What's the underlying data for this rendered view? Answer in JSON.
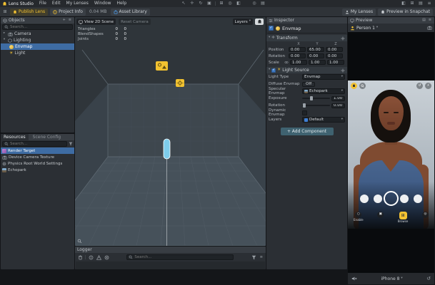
{
  "menubar": {
    "app_title": "Lens Studio",
    "items": [
      "File",
      "Edit",
      "My Lenses",
      "Window",
      "Help"
    ]
  },
  "toolbar": {
    "publish_label": "Publish Lens",
    "project_info_label": "Project Info",
    "project_size": "0.04 MB",
    "asset_library_label": "Asset Library",
    "my_lenses_label": "My Lenses",
    "preview_snapchat_label": "Preview in Snapchat"
  },
  "objects_panel": {
    "title": "Objects",
    "search_placeholder": "Search...",
    "items": [
      {
        "label": "Camera",
        "depth": 0,
        "selected": false
      },
      {
        "label": "Lighting",
        "depth": 0,
        "selected": false
      },
      {
        "label": "Envmap",
        "depth": 1,
        "selected": true
      },
      {
        "label": "Light",
        "depth": 1,
        "selected": false
      }
    ]
  },
  "resources_panel": {
    "tabs": [
      {
        "label": "Resources",
        "active": true
      },
      {
        "label": "Scene Config",
        "active": false
      }
    ],
    "search_placeholder": "Search...",
    "items": [
      {
        "label": "Render Target",
        "selected": true
      },
      {
        "label": "Device Camera Texture",
        "selected": false
      },
      {
        "label": "Physics Root World Settings",
        "selected": false
      },
      {
        "label": "Echopark",
        "selected": false
      }
    ]
  },
  "scene_panel": {
    "tab_active": "View 2D Scene",
    "tab_secondary": "Reset Camera",
    "layers_label": "Layers",
    "stats": [
      {
        "label": "Triangles",
        "scene": "0",
        "total": "0"
      },
      {
        "label": "BlendShapes",
        "scene": "0",
        "total": "0"
      },
      {
        "label": "Joints",
        "scene": "0",
        "total": "0"
      }
    ]
  },
  "logger_panel": {
    "title": "Logger",
    "search_placeholder": "Search..."
  },
  "inspector": {
    "title": "Inspector",
    "object_name": "Envmap",
    "transform": {
      "section": "Transform",
      "axes": [
        "X",
        "Y",
        "Z"
      ],
      "rows": [
        {
          "label": "Position",
          "values": [
            "0.00",
            "65.00",
            "0.00"
          ]
        },
        {
          "label": "Rotation",
          "values": [
            "0.00",
            "0.00",
            "0.00"
          ]
        },
        {
          "label": "Scale",
          "values": [
            "1.00",
            "1.00",
            "1.00"
          ]
        }
      ]
    },
    "light_source": {
      "section": "Light Source",
      "light_type_label": "Light Type",
      "light_type_value": "Envmap",
      "diffuse_label": "Diffuse Envmap",
      "diffuse_value": "Off",
      "specular_label": "Specular Envmap",
      "specular_value": "Echopark",
      "exposure_label": "Exposure",
      "exposure_value": "1.00",
      "rotation_label": "Rotation",
      "rotation_value": "0.00",
      "dynamic_label": "Dynamic Envmap",
      "layers_label": "Layers",
      "layers_value": "Default"
    },
    "add_component_label": "+ Add Component"
  },
  "preview_panel": {
    "title": "Preview",
    "source_label": "Person 1",
    "enable_label": "Enable",
    "browse_label": "Browse",
    "device_label": "iPhone 8"
  },
  "icons": {
    "chevron_down": "▾",
    "chevron_right": "▸",
    "menu": "≡",
    "plus": "+",
    "close": "✕",
    "check": "✓",
    "sun": "☀",
    "select": "↖",
    "move": "✛",
    "rotate": "↻",
    "scale": "▣",
    "grid": "⊞",
    "dot": "◎",
    "columns": "▤",
    "half": "◧",
    "flash": "⚡",
    "flip": "↺"
  }
}
